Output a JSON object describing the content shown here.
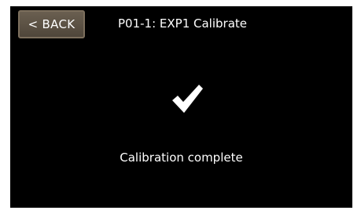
{
  "header": {
    "back_label": "< BACK",
    "title": "P01-1: EXP1 Calibrate"
  },
  "main": {
    "icon": "checkmark-icon",
    "message": "Calibration complete"
  },
  "colors": {
    "background": "#000000",
    "text": "#ffffff",
    "back_button": "#5c5245"
  }
}
